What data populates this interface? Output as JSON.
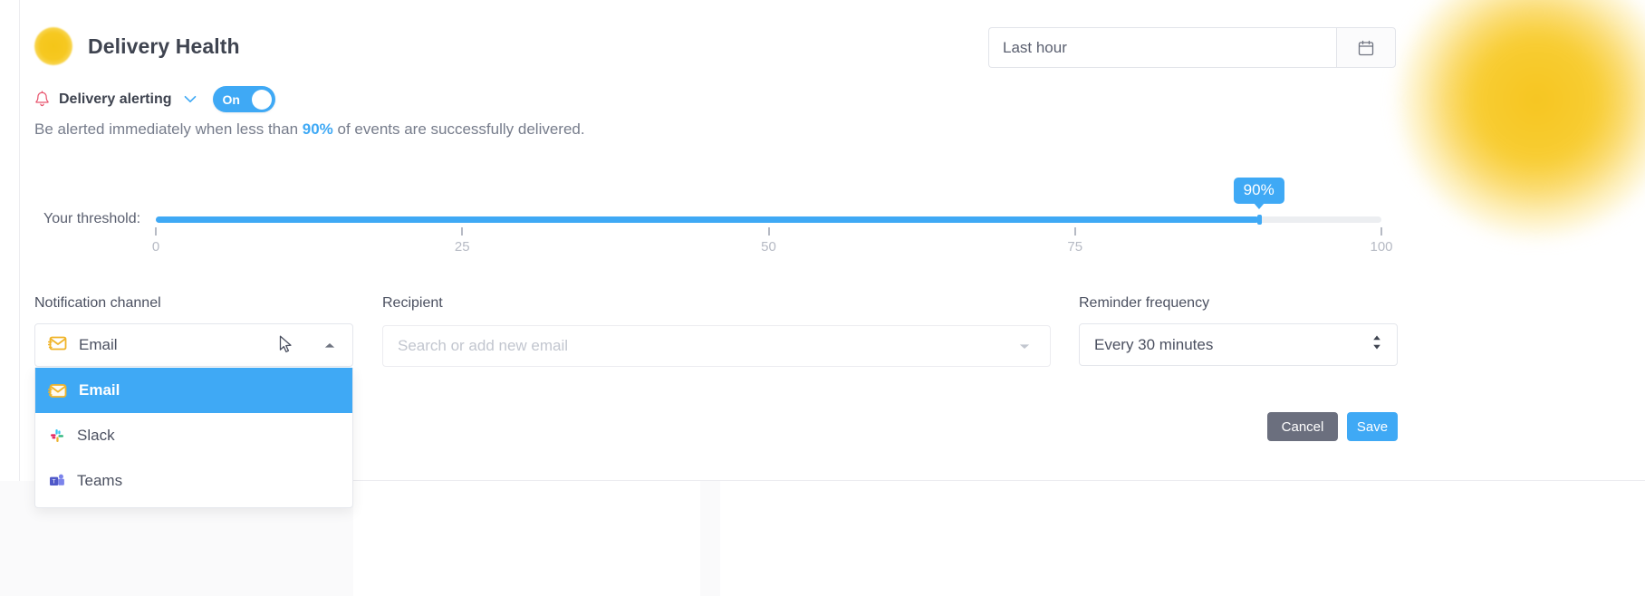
{
  "header": {
    "title": "Delivery Health",
    "sun_icon": "sun-icon"
  },
  "daterange": {
    "value": "Last hour",
    "placeholder": "Last hour",
    "calendar_icon": "calendar-icon"
  },
  "alerting": {
    "bell_icon": "bell-icon",
    "label": "Delivery alerting",
    "chevron_icon": "chevron-down-icon",
    "toggle_state": "On",
    "toggle_on": true
  },
  "description": {
    "prefix": "Be alerted immediately when less than ",
    "highlight": "90%",
    "suffix": " of events are successfully delivered."
  },
  "slider": {
    "label": "Your threshold:",
    "value": 90,
    "badge": "90%",
    "min": 0,
    "max": 100,
    "ticks": [
      {
        "value": 0,
        "label": "0"
      },
      {
        "value": 25,
        "label": "25"
      },
      {
        "value": 50,
        "label": "50"
      },
      {
        "value": 75,
        "label": "75"
      },
      {
        "value": 100,
        "label": "100"
      }
    ],
    "fill_color": "#3fa9f5",
    "track_color": "#eceef1"
  },
  "form": {
    "channel": {
      "label": "Notification channel",
      "selected": "Email",
      "selected_icon": "email-icon",
      "expanded": true,
      "caret_icon": "caret-up-icon",
      "options": [
        {
          "label": "Email",
          "icon": "email-icon",
          "selected": true
        },
        {
          "label": "Slack",
          "icon": "slack-icon",
          "selected": false
        },
        {
          "label": "Teams",
          "icon": "teams-icon",
          "selected": false
        }
      ]
    },
    "recipient": {
      "label": "Recipient",
      "value": "",
      "placeholder": "Search or add new email",
      "caret_icon": "caret-down-icon"
    },
    "reminder": {
      "label": "Reminder frequency",
      "selected": "Every 30 minutes",
      "stepper_icon": "updown-stepper-icon"
    }
  },
  "actions": {
    "cancel_label": "Cancel",
    "save_label": "Save",
    "cancel_color": "#6b6f7e",
    "save_color": "#3fa9f5"
  },
  "colors": {
    "accent": "#3fa9f5",
    "sun": "#f4c518",
    "text": "#4b5060",
    "muted": "#b6bac4"
  }
}
